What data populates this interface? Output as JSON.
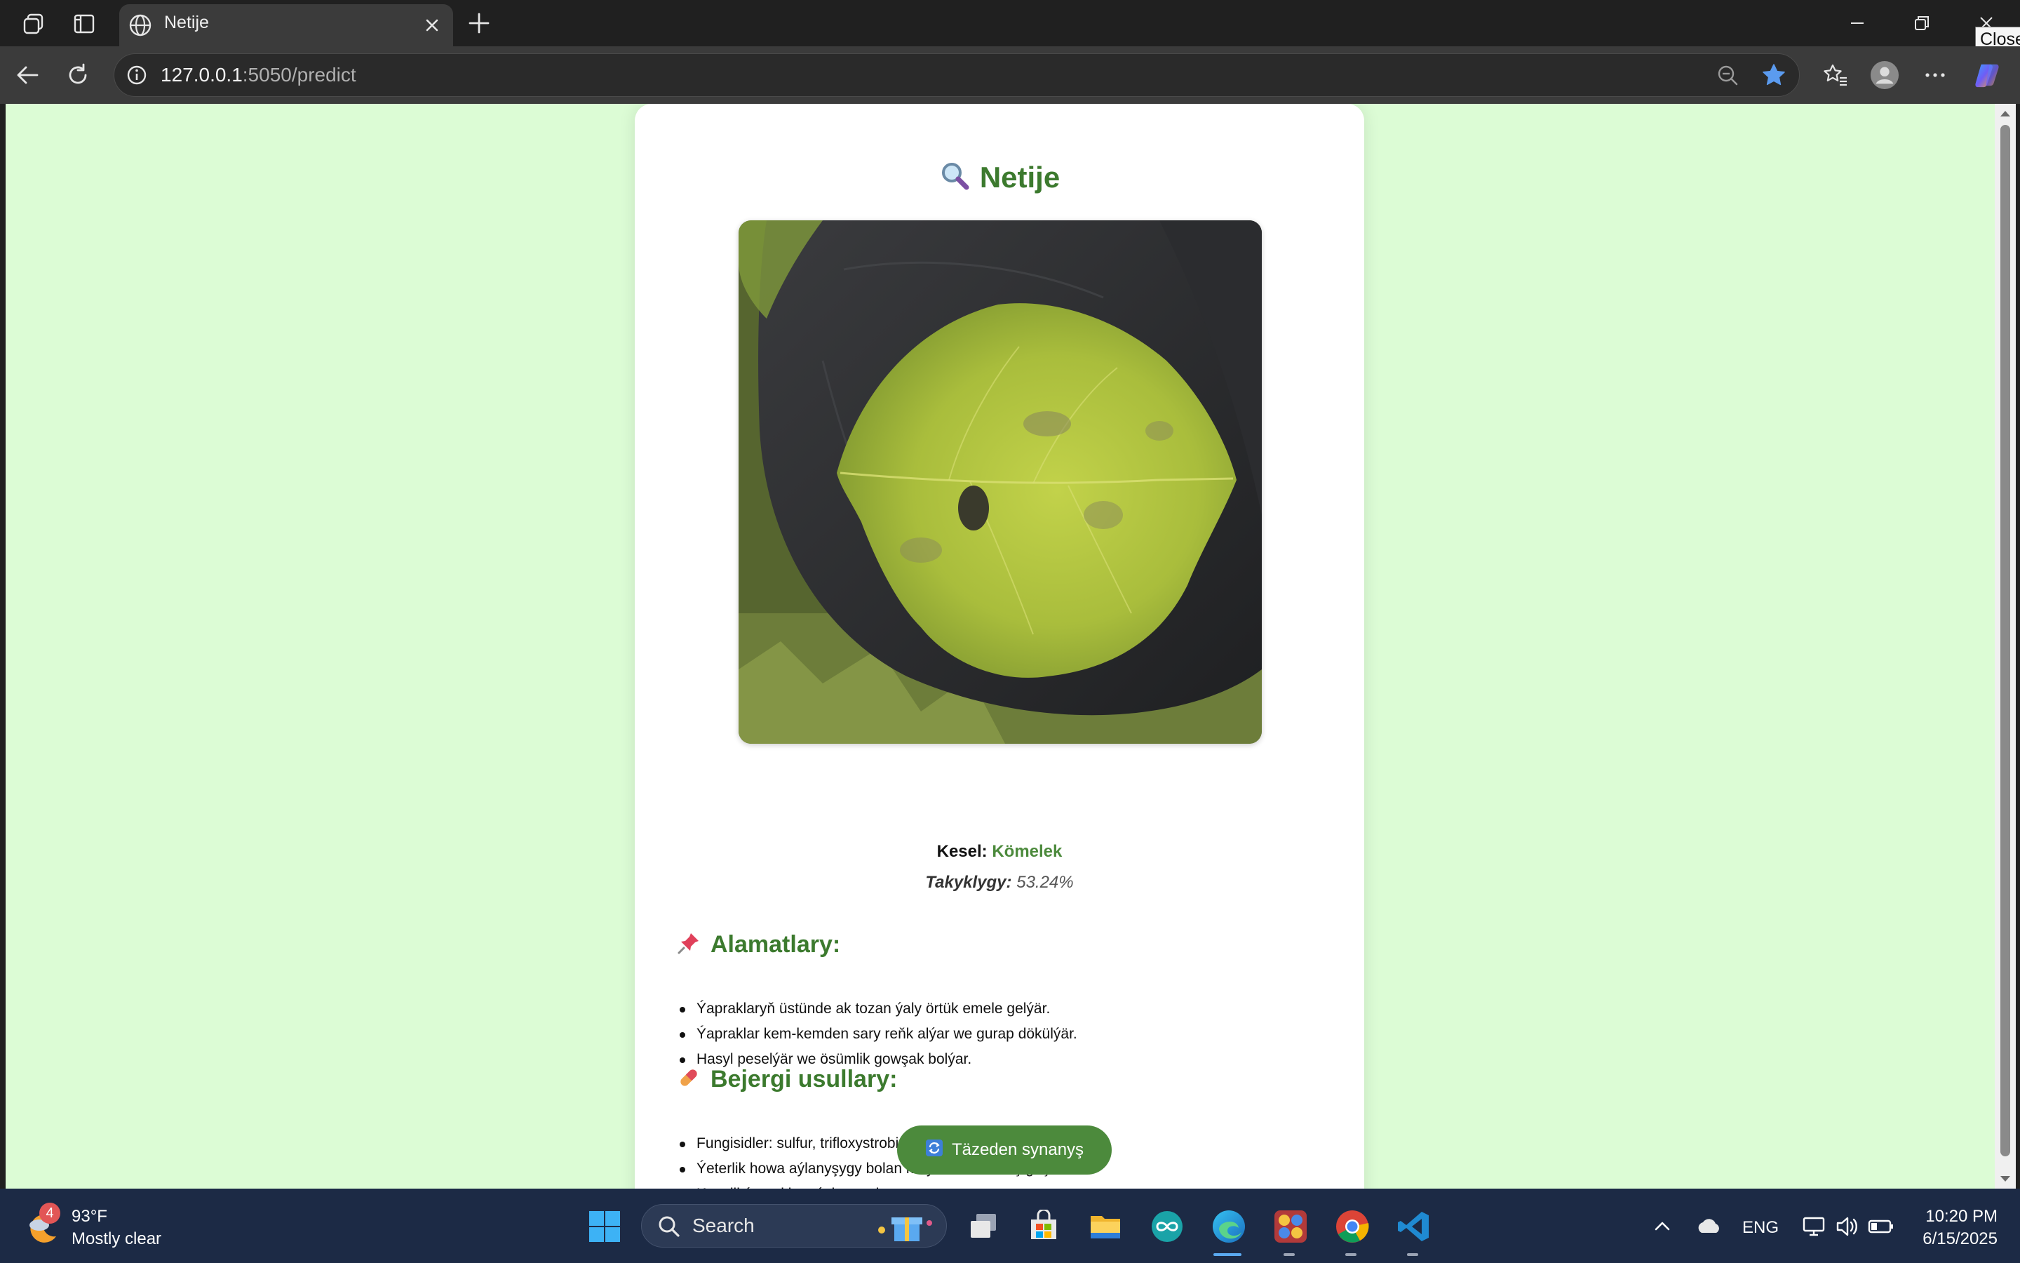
{
  "browser": {
    "tab_title": "Netije",
    "url_host": "127.0.0.1",
    "url_path": ":5050/predict",
    "tooltip": "Close"
  },
  "page": {
    "heading": "Netije",
    "heading_emoji": "🔍",
    "disease_label": "Kesel:",
    "disease_value": "Kömelek",
    "confidence_label": "Takyklygy:",
    "confidence_value": "53.24%",
    "symptoms_emoji": "📌",
    "symptoms_title": "Alamatlary:",
    "symptoms": [
      "Ýapraklaryň üstünde ak tozan ýaly örtük emele gelýär.",
      "Ýapraklar kem-kemden sary reňk alýar we gurap dökülýär.",
      "Hasyl peselýär we ösümlik gowşak bolýar."
    ],
    "treatment_emoji": "💊",
    "treatment_title": "Bejergi usullary:",
    "treatments": [
      "Fungisidler: sulfur, trifloxystrobin ýaly serişdelerdir.",
      "Ýeterlik howa aýlanyşygy bolan meýdanlarda ekiş geçirmek.",
      "Keselli ýapraklary ýok etmek."
    ],
    "retry_button": "Täzeden synanyş",
    "retry_emoji": "🔄"
  },
  "taskbar": {
    "weather_badge": "4",
    "weather_temp": "93°F",
    "weather_condition": "Mostly clear",
    "search_label": "Search",
    "language": "ENG",
    "time": "10:20 PM",
    "date": "6/15/2025"
  },
  "colors": {
    "page_bg": "#dcfcd5",
    "accent_green": "#4c8a3c",
    "heading_green": "#3c7a2e",
    "taskbar_bg": "#1c2a45"
  },
  "icons": {
    "titlebar": [
      "workspaces-icon",
      "vertical-tabs-icon",
      "globe-icon",
      "close-tab-icon",
      "new-tab-icon"
    ],
    "toolbar": [
      "back-icon",
      "refresh-icon",
      "site-info-icon",
      "zoom-out-icon",
      "favorite-star-icon",
      "favorites-icon",
      "profile-icon",
      "more-icon",
      "copilot-icon"
    ]
  }
}
